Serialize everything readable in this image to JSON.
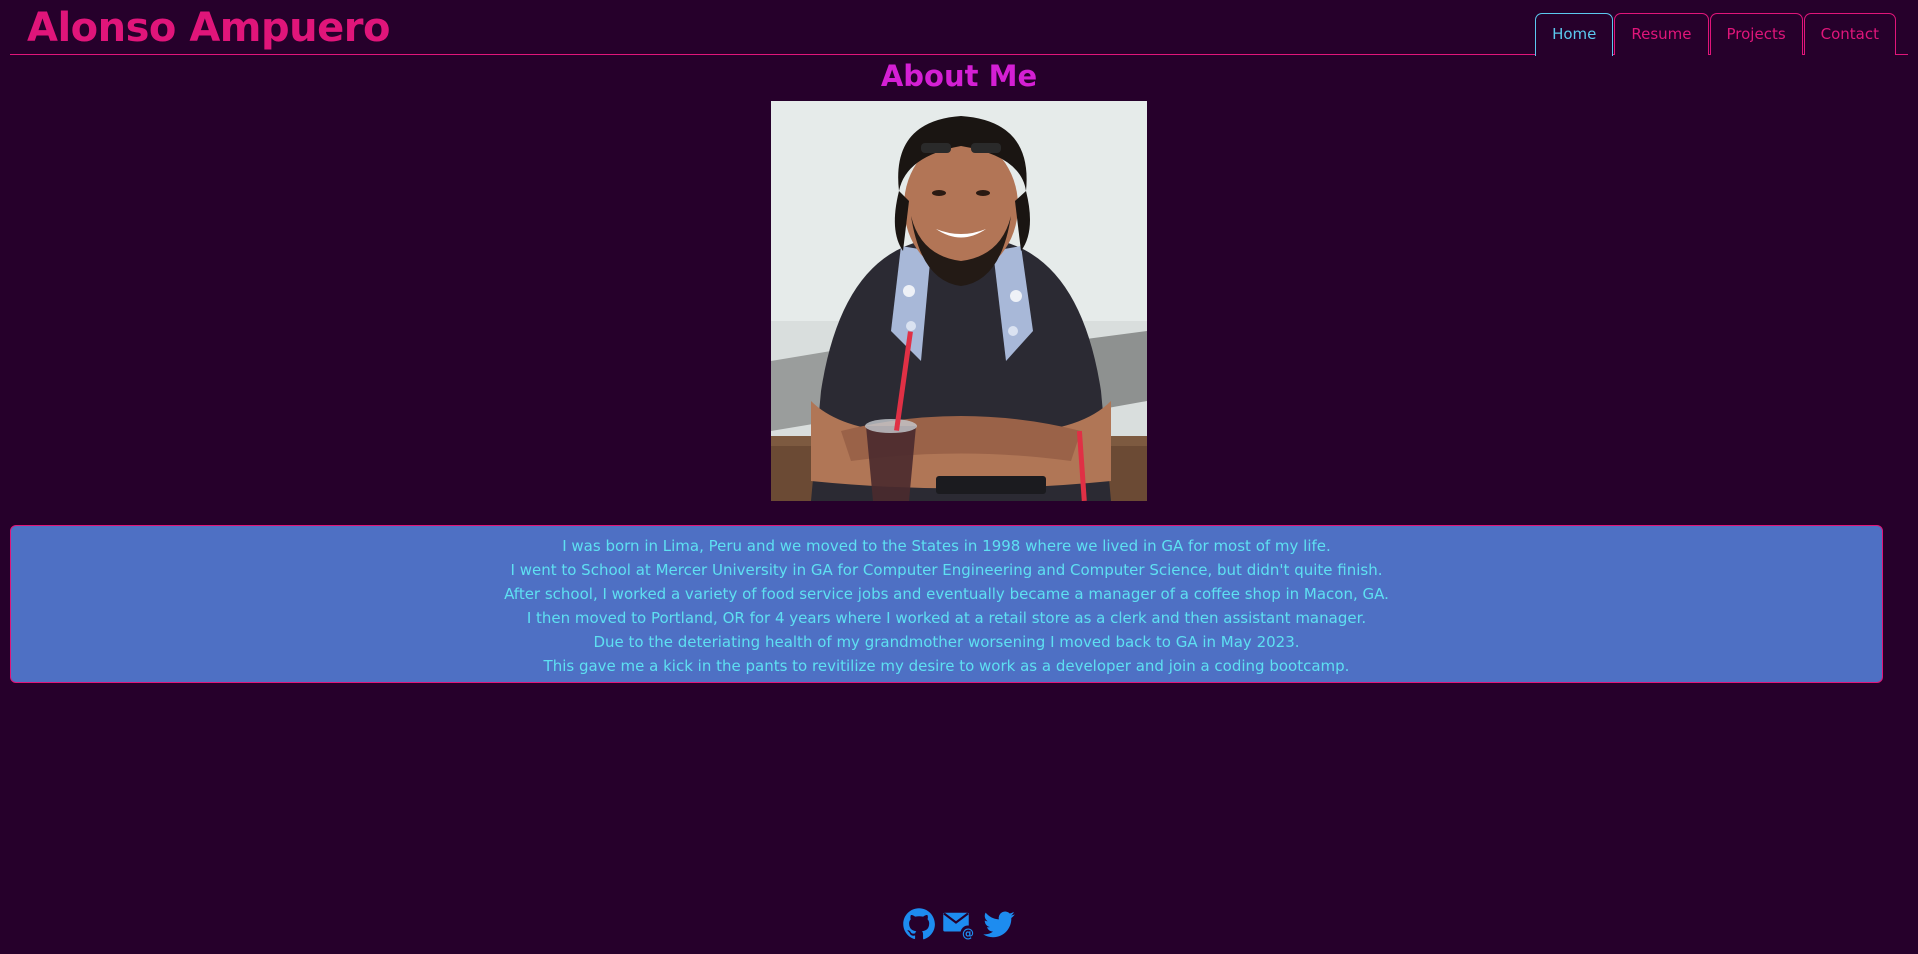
{
  "header": {
    "site_name": "Alonso Ampuero"
  },
  "nav": {
    "tabs": [
      {
        "label": "Home",
        "active": true
      },
      {
        "label": "Resume",
        "active": false
      },
      {
        "label": "Projects",
        "active": false
      },
      {
        "label": "Contact",
        "active": false
      }
    ]
  },
  "main": {
    "title": "About Me",
    "bio": [
      "I was born in Lima, Peru and we moved to the States in 1998 where we lived in GA for most of my life.",
      "I went to School at Mercer University in GA for Computer Engineering and Computer Science, but didn't quite finish.",
      "After school, I worked a variety of food service jobs and eventually became a manager of a coffee shop in Macon, GA.",
      "I then moved to Portland, OR for 4 years where I worked at a retail store as a clerk and then assistant manager.",
      "Due to the deteriating health of my grandmother worsening I moved back to GA in May 2023.",
      "This gave me a kick in the pants to revitilize my desire to work as a developer and join a coding bootcamp."
    ]
  },
  "footer": {
    "icons": [
      "github-icon",
      "email-icon",
      "twitter-icon"
    ]
  },
  "colors": {
    "background": "#26002b",
    "accent": "#e0157a",
    "active_tab": "#5bc8ee",
    "title": "#d41fd4",
    "bio_background": "#4e70c4",
    "bio_text": "#5ee0f2",
    "footer_icons": "#1d8cf0"
  }
}
